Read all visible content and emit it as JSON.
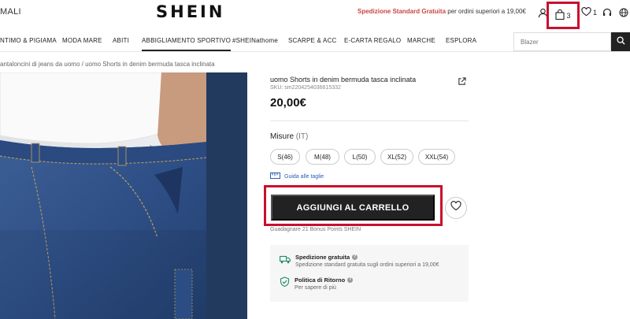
{
  "header": {
    "left_text": "MALI",
    "logo": "SHEIN",
    "promo_strong": "Spedizione Standard Gratuita",
    "promo_rest": " per ordini superiori a 19,00€",
    "bag_count": "3",
    "wishlist_count": "1"
  },
  "nav": {
    "items": [
      "NTIMO & PIGIAMA",
      "MODA MARE",
      "ABITI",
      "ABBIGLIAMENTO SPORTIVO",
      "#SHEINathome",
      "SCARPE & ACC",
      "E-CARTA REGALO",
      "MARCHE",
      "ESPLORA"
    ],
    "active_index": 3,
    "search_placeholder": "Blazer"
  },
  "breadcrumb": "antaloncini di jeans da uomo  /   uomo Shorts in denim bermuda tasca inclinata",
  "product": {
    "title": "uomo Shorts in denim bermuda tasca inclinata",
    "sku": "SKU: sm2204254036615332",
    "price": "20,00€",
    "sizes_label": "Misure",
    "sizes_unit": " (IT)",
    "sizes": [
      "S(46)",
      "M(48)",
      "L(50)",
      "XL(52)",
      "XXL(54)"
    ],
    "size_guide": "Guida alle taglie",
    "add_to_cart": "AGGIUNGI AL CARRELLO",
    "bonus": "Guadagnare 21 Bonus Points SHEIN"
  },
  "shipping": {
    "free_title": "Spedizione gratuita",
    "free_desc": "Spedizione standard gratuita sugli ordini superiori a 19,00€",
    "return_title": "Politica di Ritorno",
    "return_desc": "Per sapere di più"
  },
  "colors": {
    "highlight": "#c8102e",
    "cta_bg": "#222222",
    "promo_red": "#cc4444",
    "link_blue": "#2a5db0"
  }
}
